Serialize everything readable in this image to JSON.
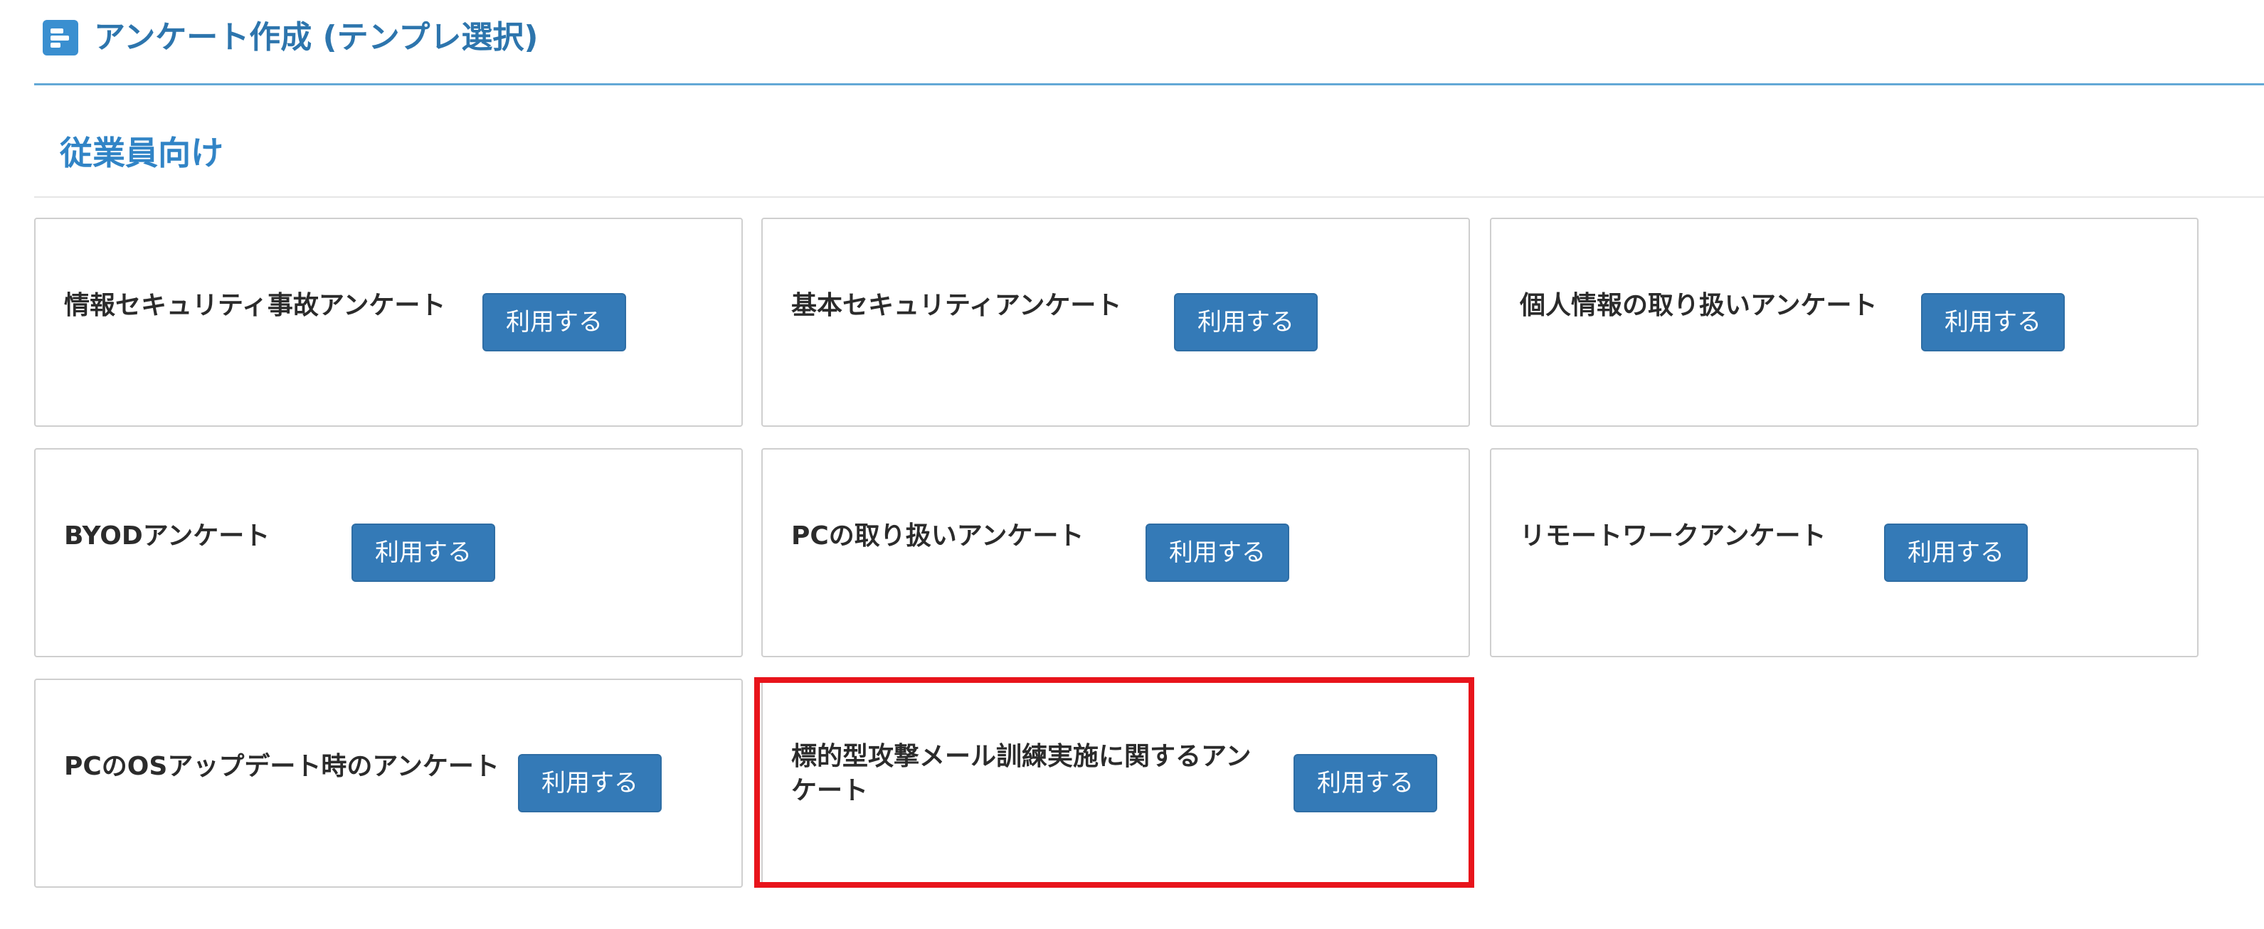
{
  "header": {
    "title": "アンケート作成 (テンプレ選択)",
    "icon": "form-list-icon"
  },
  "section": {
    "title": "従業員向け"
  },
  "cards": [
    {
      "label": "情報セキュリティ事故アンケート",
      "button": "利用する"
    },
    {
      "label": "基本セキュリティアンケート",
      "button": "利用する"
    },
    {
      "label": "個人情報の取り扱いアンケート",
      "button": "利用する"
    },
    {
      "label": "BYODアンケート",
      "button": "利用する"
    },
    {
      "label": "PCの取り扱いアンケート",
      "button": "利用する"
    },
    {
      "label": "リモートワークアンケート",
      "button": "利用する"
    },
    {
      "label": "PCのOSアップデート時のアンケート",
      "button": "利用する"
    },
    {
      "label": "標的型攻撃メール訓練実施に関するアンケート",
      "button": "利用する"
    }
  ],
  "colors": {
    "accent": "#347ab7",
    "title": "#2d75ad",
    "highlight": "#e8141b"
  }
}
